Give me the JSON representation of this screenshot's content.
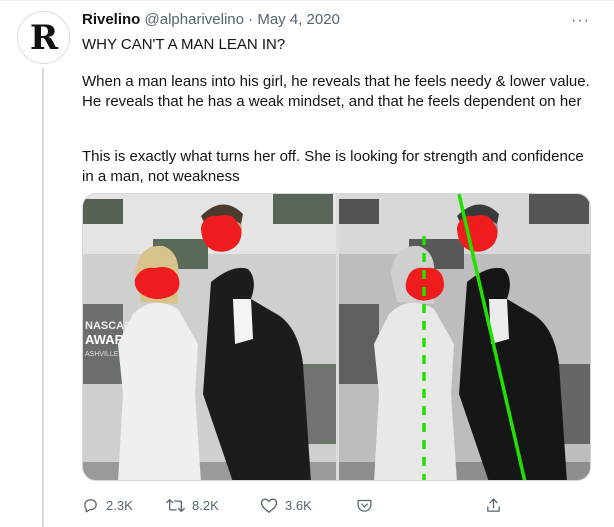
{
  "tweet": {
    "avatar_letter": "R",
    "author_name": "Rivelino",
    "author_handle": "@alpharivelino",
    "separator": "·",
    "date": "May 4, 2020",
    "more_label": "···",
    "line1": "WHY CAN'T A MAN LEAN IN?",
    "para1": "When a man leans into his girl, he reveals that he feels needy & lower value. He reveals that he has a weak mindset, and that he feels dependent on her",
    "para2": "This is exactly what turns her off. She is looking for strength and confidence in a man, not weakness"
  },
  "media": {
    "backdrop_text_left": [
      "NASCAR",
      "AWARDS",
      "ASHVILLE"
    ],
    "overlay_line_color": "#22e000",
    "redaction_color": "#ee1c1c"
  },
  "actions": {
    "reply_count": "2.3K",
    "retweet_count": "8.2K",
    "like_count": "3.6K"
  }
}
